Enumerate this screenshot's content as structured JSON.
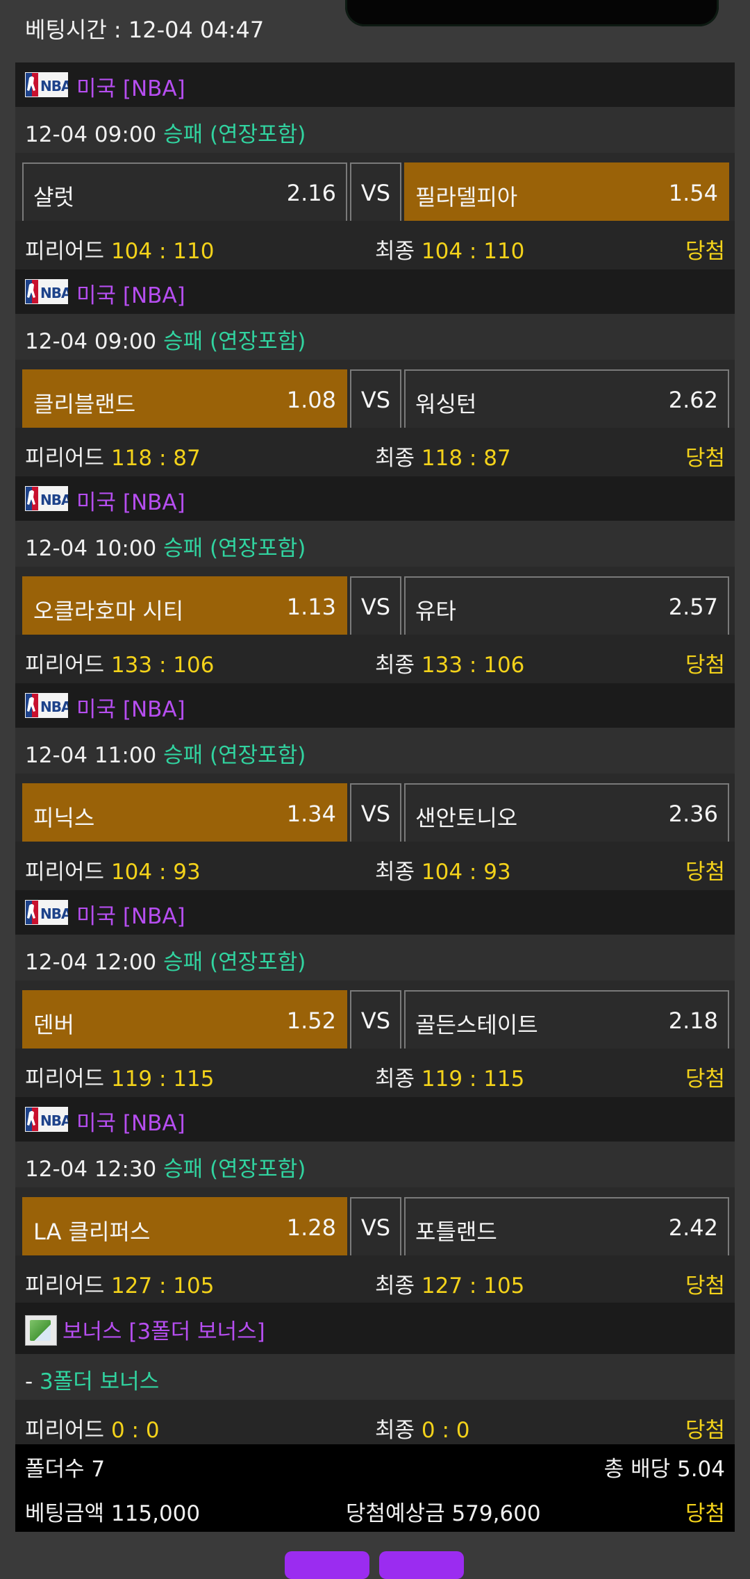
{
  "header": {
    "bet_time": "베팅시간 : 12-04 04:47"
  },
  "matches": [
    {
      "league": "미국 [NBA]",
      "datetime": "12-04 09:00",
      "market": "승패 (연장포함)",
      "home": "샬럿",
      "home_odds": "2.16",
      "vs": "VS",
      "away": "필라델피아",
      "away_odds": "1.54",
      "selected": "away",
      "period_label": "피리어드",
      "period_score": "104 : 110",
      "final_label": "최종",
      "final_score": "104 : 110",
      "result": "당첨"
    },
    {
      "league": "미국 [NBA]",
      "datetime": "12-04 09:00",
      "market": "승패 (연장포함)",
      "home": "클리블랜드",
      "home_odds": "1.08",
      "vs": "VS",
      "away": "워싱턴",
      "away_odds": "2.62",
      "selected": "home",
      "period_label": "피리어드",
      "period_score": "118 : 87",
      "final_label": "최종",
      "final_score": "118 : 87",
      "result": "당첨"
    },
    {
      "league": "미국 [NBA]",
      "datetime": "12-04 10:00",
      "market": "승패 (연장포함)",
      "home": "오클라호마 시티",
      "home_odds": "1.13",
      "vs": "VS",
      "away": "유타",
      "away_odds": "2.57",
      "selected": "home",
      "period_label": "피리어드",
      "period_score": "133 : 106",
      "final_label": "최종",
      "final_score": "133 : 106",
      "result": "당첨"
    },
    {
      "league": "미국 [NBA]",
      "datetime": "12-04 11:00",
      "market": "승패 (연장포함)",
      "home": "피닉스",
      "home_odds": "1.34",
      "vs": "VS",
      "away": "샌안토니오",
      "away_odds": "2.36",
      "selected": "home",
      "period_label": "피리어드",
      "period_score": "104 : 93",
      "final_label": "최종",
      "final_score": "104 : 93",
      "result": "당첨"
    },
    {
      "league": "미국 [NBA]",
      "datetime": "12-04 12:00",
      "market": "승패 (연장포함)",
      "home": "덴버",
      "home_odds": "1.52",
      "vs": "VS",
      "away": "골든스테이트",
      "away_odds": "2.18",
      "selected": "home",
      "period_label": "피리어드",
      "period_score": "119 : 115",
      "final_label": "최종",
      "final_score": "119 : 115",
      "result": "당첨"
    },
    {
      "league": "미국 [NBA]",
      "datetime": "12-04 12:30",
      "market": "승패 (연장포함)",
      "home": "LA 클리퍼스",
      "home_odds": "1.28",
      "vs": "VS",
      "away": "포틀랜드",
      "away_odds": "2.42",
      "selected": "home",
      "period_label": "피리어드",
      "period_score": "127 : 105",
      "final_label": "최종",
      "final_score": "127 : 105",
      "result": "당첨"
    }
  ],
  "bonus": {
    "title": "보너스 [3폴더 보너스]",
    "prefix": "- ",
    "detail": "3폴더 보너스",
    "period_label": "피리어드",
    "period_score": "0 : 0",
    "final_label": "최종",
    "final_score": "0 : 0",
    "result": "당첨"
  },
  "summary": {
    "folder_count": "폴더수 7",
    "total_odds": "총 배당 5.04",
    "bet_amount": "베팅금액 115,000",
    "expected_win": "당첨예상금 579,600",
    "status": "당첨"
  },
  "colors": {
    "selected_bg": "#9a6208",
    "league_text": "#b64ef0",
    "market_text": "#31d4a0",
    "score_text": "#f3d21a"
  }
}
